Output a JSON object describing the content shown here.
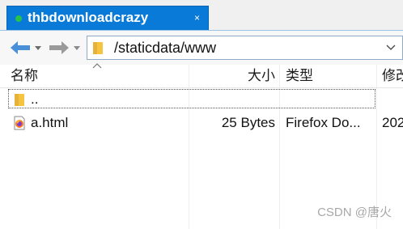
{
  "tab": {
    "title": "thbdownloadcrazy",
    "close_glyph": "×",
    "status_color": "#27c24a",
    "accent_color": "#0a7ad8"
  },
  "toolbar": {
    "back_icon": "arrow-left-icon",
    "forward_icon": "arrow-right-icon",
    "address": "/staticdata/www",
    "address_icon": "folder-icon"
  },
  "columns": {
    "name": "名称",
    "size": "大小",
    "type": "类型",
    "modified": "修改"
  },
  "rows": [
    {
      "icon": "folder-icon",
      "name": "..",
      "size": "",
      "type": "",
      "modified": ""
    },
    {
      "icon": "firefox-html-icon",
      "name": "a.html",
      "size": "25 Bytes",
      "type": "Firefox Do...",
      "modified": "202"
    }
  ],
  "watermark": "CSDN @唐火"
}
